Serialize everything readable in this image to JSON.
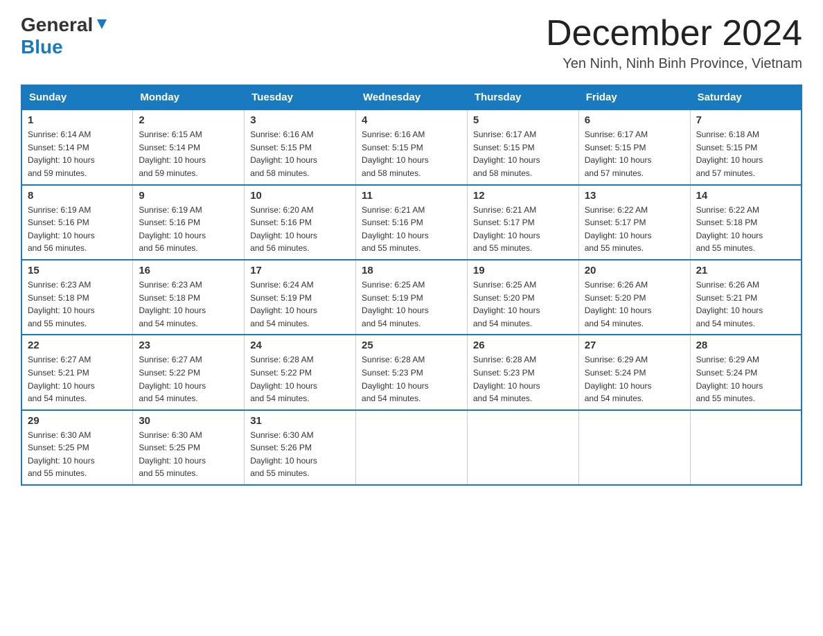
{
  "header": {
    "logo_general": "General",
    "logo_blue": "Blue",
    "title": "December 2024",
    "subtitle": "Yen Ninh, Ninh Binh Province, Vietnam"
  },
  "days_of_week": [
    "Sunday",
    "Monday",
    "Tuesday",
    "Wednesday",
    "Thursday",
    "Friday",
    "Saturday"
  ],
  "weeks": [
    [
      {
        "day": "1",
        "sunrise": "6:14 AM",
        "sunset": "5:14 PM",
        "daylight": "10 hours and 59 minutes."
      },
      {
        "day": "2",
        "sunrise": "6:15 AM",
        "sunset": "5:14 PM",
        "daylight": "10 hours and 59 minutes."
      },
      {
        "day": "3",
        "sunrise": "6:16 AM",
        "sunset": "5:15 PM",
        "daylight": "10 hours and 58 minutes."
      },
      {
        "day": "4",
        "sunrise": "6:16 AM",
        "sunset": "5:15 PM",
        "daylight": "10 hours and 58 minutes."
      },
      {
        "day": "5",
        "sunrise": "6:17 AM",
        "sunset": "5:15 PM",
        "daylight": "10 hours and 58 minutes."
      },
      {
        "day": "6",
        "sunrise": "6:17 AM",
        "sunset": "5:15 PM",
        "daylight": "10 hours and 57 minutes."
      },
      {
        "day": "7",
        "sunrise": "6:18 AM",
        "sunset": "5:15 PM",
        "daylight": "10 hours and 57 minutes."
      }
    ],
    [
      {
        "day": "8",
        "sunrise": "6:19 AM",
        "sunset": "5:16 PM",
        "daylight": "10 hours and 56 minutes."
      },
      {
        "day": "9",
        "sunrise": "6:19 AM",
        "sunset": "5:16 PM",
        "daylight": "10 hours and 56 minutes."
      },
      {
        "day": "10",
        "sunrise": "6:20 AM",
        "sunset": "5:16 PM",
        "daylight": "10 hours and 56 minutes."
      },
      {
        "day": "11",
        "sunrise": "6:21 AM",
        "sunset": "5:16 PM",
        "daylight": "10 hours and 55 minutes."
      },
      {
        "day": "12",
        "sunrise": "6:21 AM",
        "sunset": "5:17 PM",
        "daylight": "10 hours and 55 minutes."
      },
      {
        "day": "13",
        "sunrise": "6:22 AM",
        "sunset": "5:17 PM",
        "daylight": "10 hours and 55 minutes."
      },
      {
        "day": "14",
        "sunrise": "6:22 AM",
        "sunset": "5:18 PM",
        "daylight": "10 hours and 55 minutes."
      }
    ],
    [
      {
        "day": "15",
        "sunrise": "6:23 AM",
        "sunset": "5:18 PM",
        "daylight": "10 hours and 55 minutes."
      },
      {
        "day": "16",
        "sunrise": "6:23 AM",
        "sunset": "5:18 PM",
        "daylight": "10 hours and 54 minutes."
      },
      {
        "day": "17",
        "sunrise": "6:24 AM",
        "sunset": "5:19 PM",
        "daylight": "10 hours and 54 minutes."
      },
      {
        "day": "18",
        "sunrise": "6:25 AM",
        "sunset": "5:19 PM",
        "daylight": "10 hours and 54 minutes."
      },
      {
        "day": "19",
        "sunrise": "6:25 AM",
        "sunset": "5:20 PM",
        "daylight": "10 hours and 54 minutes."
      },
      {
        "day": "20",
        "sunrise": "6:26 AM",
        "sunset": "5:20 PM",
        "daylight": "10 hours and 54 minutes."
      },
      {
        "day": "21",
        "sunrise": "6:26 AM",
        "sunset": "5:21 PM",
        "daylight": "10 hours and 54 minutes."
      }
    ],
    [
      {
        "day": "22",
        "sunrise": "6:27 AM",
        "sunset": "5:21 PM",
        "daylight": "10 hours and 54 minutes."
      },
      {
        "day": "23",
        "sunrise": "6:27 AM",
        "sunset": "5:22 PM",
        "daylight": "10 hours and 54 minutes."
      },
      {
        "day": "24",
        "sunrise": "6:28 AM",
        "sunset": "5:22 PM",
        "daylight": "10 hours and 54 minutes."
      },
      {
        "day": "25",
        "sunrise": "6:28 AM",
        "sunset": "5:23 PM",
        "daylight": "10 hours and 54 minutes."
      },
      {
        "day": "26",
        "sunrise": "6:28 AM",
        "sunset": "5:23 PM",
        "daylight": "10 hours and 54 minutes."
      },
      {
        "day": "27",
        "sunrise": "6:29 AM",
        "sunset": "5:24 PM",
        "daylight": "10 hours and 54 minutes."
      },
      {
        "day": "28",
        "sunrise": "6:29 AM",
        "sunset": "5:24 PM",
        "daylight": "10 hours and 55 minutes."
      }
    ],
    [
      {
        "day": "29",
        "sunrise": "6:30 AM",
        "sunset": "5:25 PM",
        "daylight": "10 hours and 55 minutes."
      },
      {
        "day": "30",
        "sunrise": "6:30 AM",
        "sunset": "5:25 PM",
        "daylight": "10 hours and 55 minutes."
      },
      {
        "day": "31",
        "sunrise": "6:30 AM",
        "sunset": "5:26 PM",
        "daylight": "10 hours and 55 minutes."
      },
      null,
      null,
      null,
      null
    ]
  ],
  "labels": {
    "sunrise": "Sunrise:",
    "sunset": "Sunset:",
    "daylight": "Daylight:"
  }
}
